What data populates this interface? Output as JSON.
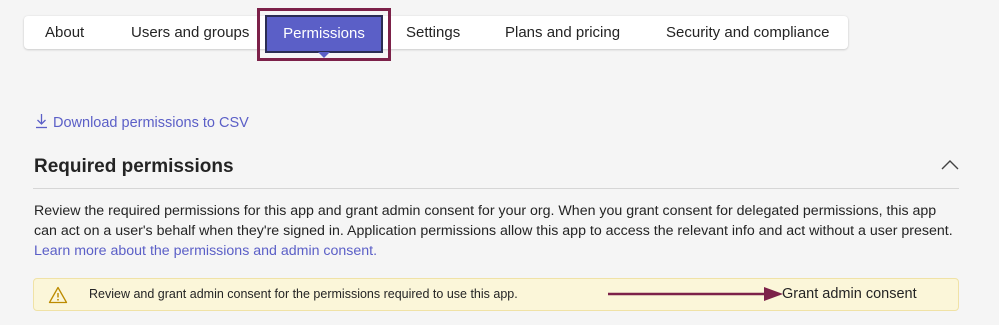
{
  "tabs": {
    "about": "About",
    "users_groups": "Users and groups",
    "permissions": "Permissions",
    "settings": "Settings",
    "plans_pricing": "Plans and pricing",
    "security_compliance": "Security and compliance"
  },
  "download_link": {
    "label": "Download permissions to CSV",
    "icon": "download-icon"
  },
  "section": {
    "title": "Required permissions",
    "collapse_icon": "chevron-up-icon",
    "description": "Review the required permissions for this app and grant admin consent for your org. When you grant consent for delegated permissions, this app can act on a user's behalf when they're signed in. Application permissions allow this app to access the relevant info and act without a user present.",
    "learn_more": "Learn more about the permissions and admin consent."
  },
  "warning": {
    "icon": "warning-icon",
    "text": "Review and grant admin consent for the permissions required to use this app.",
    "action_label": "Grant admin consent"
  },
  "colors": {
    "accent": "#5b5fc7",
    "annotation": "#7c2149",
    "warning_background": "#fbf6d9"
  }
}
